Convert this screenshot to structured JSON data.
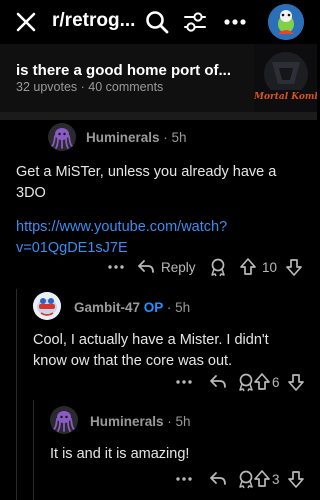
{
  "header": {
    "title": "r/retrog...",
    "icons": [
      "close-icon",
      "search-icon",
      "filter-icon",
      "more-icon",
      "avatar"
    ]
  },
  "post": {
    "title": "is there a good home port of...",
    "meta": "32 upvotes · 40 comments",
    "thumbnail_text": "Mortal Kombat II"
  },
  "comments": [
    {
      "author": "Huminerals",
      "age": "· 5h",
      "body_lines": [
        "Get a MiSTer, unless you already have a",
        "3DO"
      ],
      "link_lines": [
        "https://www.youtube.com/watch?",
        "v=01QgDE1sJ7E"
      ],
      "reply_label": "Reply",
      "votes": "10"
    },
    {
      "author": "Gambit-47",
      "op": "OP",
      "age": "· 5h",
      "body_lines": [
        "Cool, I actually have a Mister. I didn't",
        "know ow that the core was out."
      ],
      "votes": "6"
    },
    {
      "author": "Huminerals",
      "age": "· 5h",
      "body_lines": [
        "It is and it is amazing!"
      ],
      "votes": "3"
    }
  ],
  "colors": {
    "background": "#000000",
    "link": "#3b8df0",
    "op_badge": "#1f93ff",
    "muted": "#9a9a9a"
  }
}
